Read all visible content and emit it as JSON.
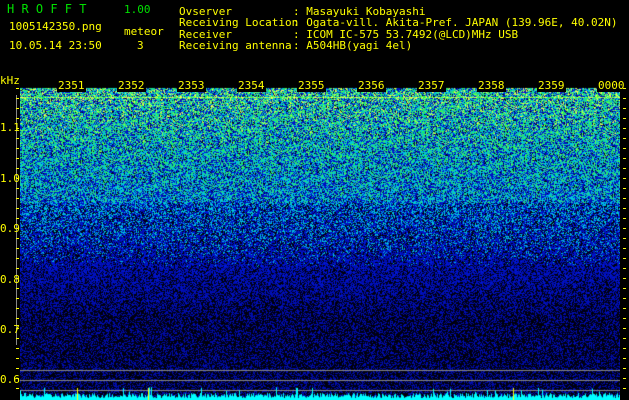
{
  "header": {
    "app_letters": "H R O F F T",
    "version": "1.00",
    "filename": "1005142350.png",
    "datetime": "10.05.14 23:50",
    "meteor_label": "meteor",
    "meteor_count": "3"
  },
  "info": [
    {
      "label": "Ovserver",
      "value": ": Masayuki Kobayashi"
    },
    {
      "label": "Receiving Location",
      "value": ": Ogata-vill. Akita-Pref. JAPAN (139.96E, 40.02N)"
    },
    {
      "label": "Receiver",
      "value": ": ICOM IC-575 53.7492(@LCD)MHz USB"
    },
    {
      "label": "Receiving antenna",
      "value": ": A504HB(yagi 4el)"
    }
  ],
  "spectrogram": {
    "unit": "kHz",
    "time_labels": [
      "2351",
      "2352",
      "2353",
      "2354",
      "2355",
      "2356",
      "2357",
      "2358",
      "2359",
      "0000"
    ],
    "freq_labels": [
      "1.1",
      "1.0",
      "0.9",
      "0.8",
      "0.7",
      "0.6"
    ]
  },
  "colors": {
    "text": "#ffff00",
    "logo": "#00e000",
    "histogram": "#00ffff"
  }
}
